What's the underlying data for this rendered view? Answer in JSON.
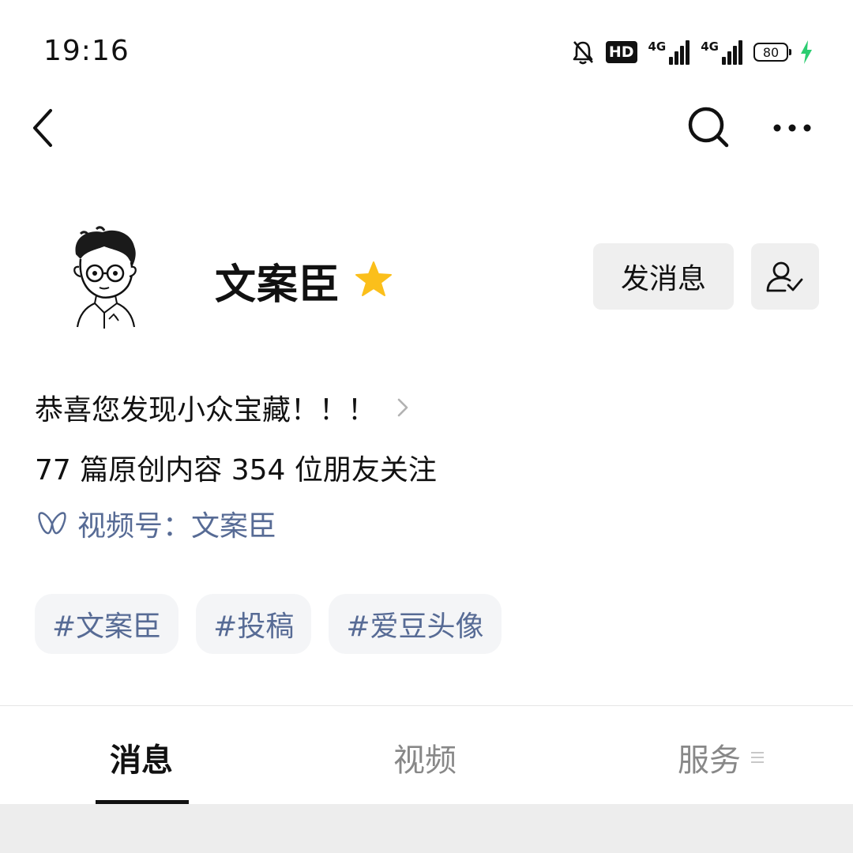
{
  "status_bar": {
    "time": "19:16",
    "hd_label": "HD",
    "network_1": "4G",
    "network_2": "4G",
    "battery_level": "80",
    "icons": [
      "bell-muted-icon",
      "hd-voice-icon",
      "signal-icon",
      "signal-icon",
      "battery-icon",
      "charging-bolt-icon"
    ],
    "charging_color": "#2ccd71"
  },
  "nav": {
    "icons": [
      "back-arrow-icon",
      "search-icon",
      "more-icon"
    ]
  },
  "profile": {
    "name": "文案臣",
    "badge_icon": "star-icon",
    "badge_color": "#fbbf1b",
    "send_message_label": "发消息",
    "follow_icon": "follow-user-icon"
  },
  "info": {
    "bio": "恭喜您发现小众宝藏！！！",
    "stats": "77 篇原创内容  354 位朋友关注",
    "channels": "视频号：文案臣",
    "link_color": "#576b95"
  },
  "tags": [
    "#文案臣",
    "#投稿",
    "#爱豆头像"
  ],
  "tabs": {
    "messages": "消息",
    "videos": "视频",
    "services": "服务",
    "active": "消息"
  }
}
